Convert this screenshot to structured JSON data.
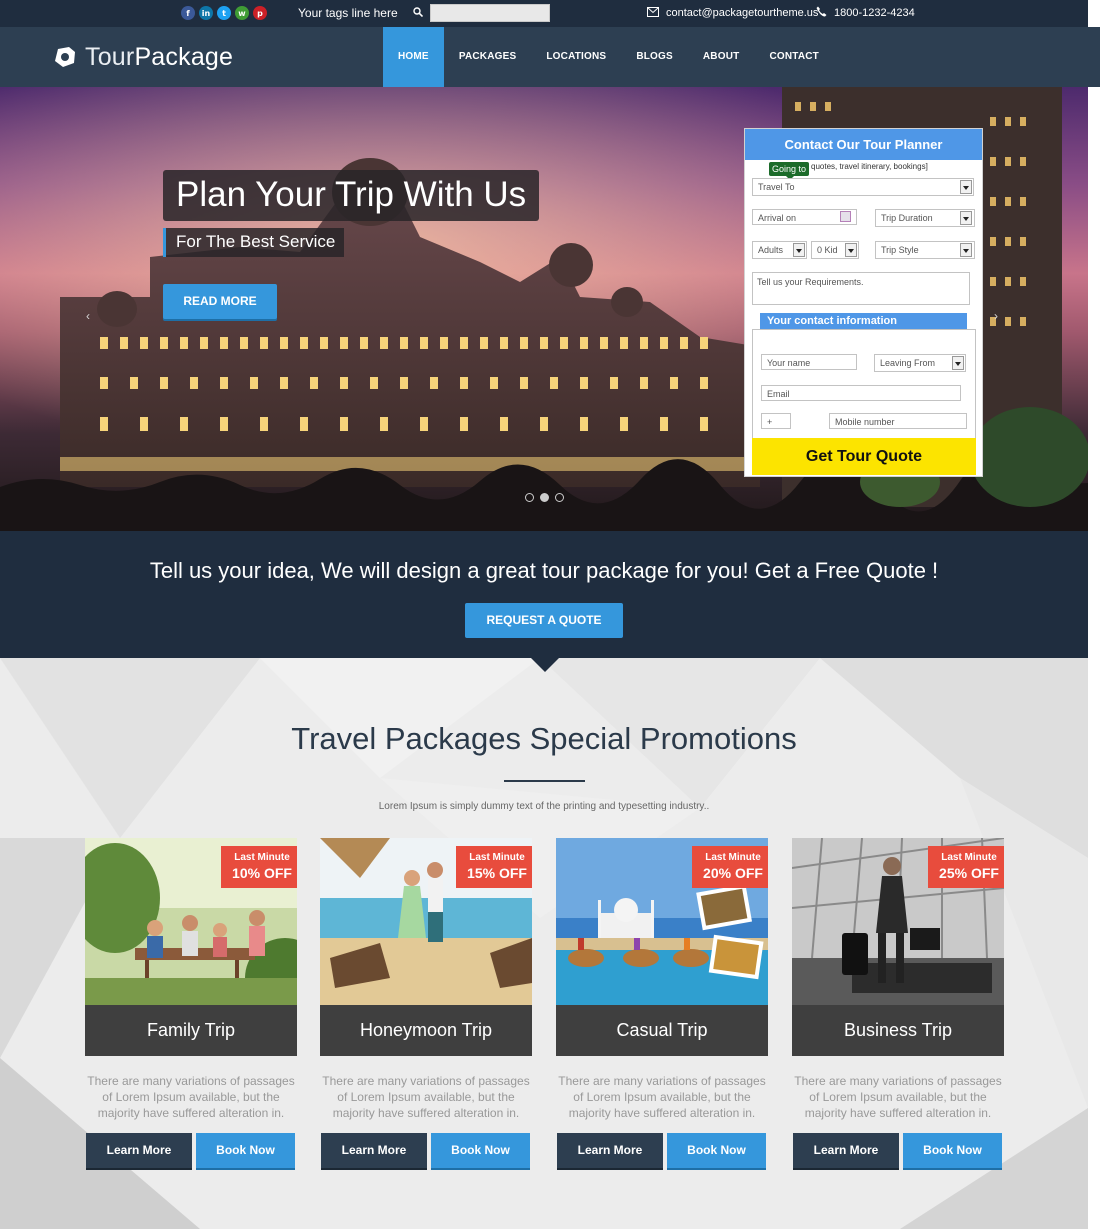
{
  "topbar": {
    "social": [
      {
        "icon": "facebook-icon",
        "glyph": "f",
        "color": "#3b5998"
      },
      {
        "icon": "linkedin-icon",
        "glyph": "in",
        "color": "#0e76a8"
      },
      {
        "icon": "twitter-icon",
        "glyph": "t",
        "color": "#1da1f2"
      },
      {
        "icon": "whatsapp-icon",
        "glyph": "w",
        "color": "#3f9c35"
      },
      {
        "icon": "pinterest-icon",
        "glyph": "p",
        "color": "#cb2027"
      }
    ],
    "tagline": "Your tags line here",
    "search_value": "",
    "email": "contact@packagetourtheme.us",
    "phone": "1800-1232-4234"
  },
  "brand": {
    "name_part1": "Tour",
    "name_part2": "Package"
  },
  "nav": {
    "items": [
      "HOME",
      "PACKAGES",
      "LOCATIONS",
      "BLOGS",
      "ABOUT",
      "CONTACT"
    ],
    "active": "HOME"
  },
  "hero": {
    "title": "Plan Your Trip With Us",
    "subtitle": "For The Best Service",
    "button": "READ MORE"
  },
  "planner": {
    "title": "Contact Our Tour Planner",
    "hint": "quotes, travel itinerary, bookings]",
    "tooltip": "Going to",
    "travel_to": "Travel To",
    "arrival": "Arrival on",
    "duration": "Trip Duration",
    "adults": "Adults",
    "kids": "0 Kid",
    "style": "Trip Style",
    "requirements": "Tell us your Requirements.",
    "contact_title": "Your contact information",
    "name": "Your name",
    "leaving": "Leaving From",
    "email": "Email",
    "code": "+",
    "mobile": "Mobile number",
    "submit": "Get Tour Quote"
  },
  "cta": {
    "text": "Tell us your idea, We will design a great tour package for you! Get a Free Quote !",
    "button": "REQUEST A QUOTE"
  },
  "promotions": {
    "title": "Travel Packages Special Promotions",
    "subtitle": "Lorem Ipsum is simply dummy text of the printing and typesetting industry..",
    "cards": [
      {
        "badge_top": "Last Minute",
        "badge_off": "10% OFF",
        "name": "Family Trip",
        "desc": "There are many variations of passages of Lorem Ipsum available, but the majority have suffered alteration in.",
        "learn": "Learn More",
        "book": "Book Now"
      },
      {
        "badge_top": "Last Minute",
        "badge_off": "15% OFF",
        "name": "Honeymoon Trip",
        "desc": "There are many variations of passages of Lorem Ipsum available, but the majority have suffered alteration in.",
        "learn": "Learn More",
        "book": "Book Now"
      },
      {
        "badge_top": "Last Minute",
        "badge_off": "20% OFF",
        "name": "Casual Trip",
        "desc": "There are many variations of passages of Lorem Ipsum available, but the majority have suffered alteration in.",
        "learn": "Learn More",
        "book": "Book Now"
      },
      {
        "badge_top": "Last Minute",
        "badge_off": "25% OFF",
        "name": "Business Trip",
        "desc": "There are many variations of passages of Lorem Ipsum available, but the majority have suffered alteration in.",
        "learn": "Learn More",
        "book": "Book Now"
      }
    ]
  },
  "colors": {
    "dark_navy": "#1f2d3f",
    "nav_bg": "#2d3f52",
    "accent_blue": "#3597dc",
    "planner_blue": "#4f97e7",
    "quote_yellow": "#fce400",
    "badge_red": "#e84c3d"
  }
}
